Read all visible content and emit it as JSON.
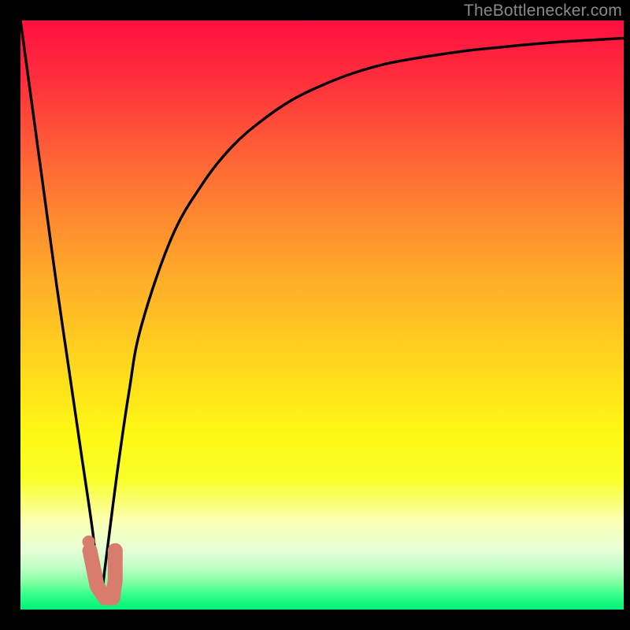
{
  "watermark": "TheBottlenecker.com",
  "colors": {
    "black": "#000000",
    "line": "#000000",
    "marker": "#d87c6e",
    "gradient_stops": [
      {
        "offset": 0.0,
        "color": "#ff0f3f"
      },
      {
        "offset": 0.1,
        "color": "#ff2f3c"
      },
      {
        "offset": 0.25,
        "color": "#ff6a35"
      },
      {
        "offset": 0.42,
        "color": "#ffa72a"
      },
      {
        "offset": 0.58,
        "color": "#ffd61e"
      },
      {
        "offset": 0.7,
        "color": "#fff714"
      },
      {
        "offset": 0.78,
        "color": "#f8ff2a"
      },
      {
        "offset": 0.85,
        "color": "#fbffb4"
      },
      {
        "offset": 0.9,
        "color": "#e6ffd5"
      },
      {
        "offset": 0.93,
        "color": "#bcffc5"
      },
      {
        "offset": 0.955,
        "color": "#7effa0"
      },
      {
        "offset": 0.975,
        "color": "#33ff8a"
      },
      {
        "offset": 1.0,
        "color": "#00f17a"
      }
    ]
  },
  "chart_data": {
    "type": "line",
    "title": "",
    "xlabel": "",
    "ylabel": "",
    "xlim": [
      0,
      100
    ],
    "ylim": [
      0,
      100
    ],
    "x": [
      0,
      2,
      4,
      6,
      8,
      10,
      12,
      13.2,
      14,
      16,
      18,
      20,
      25,
      30,
      35,
      40,
      45,
      50,
      55,
      60,
      65,
      70,
      75,
      80,
      85,
      90,
      95,
      100
    ],
    "values": [
      100,
      85,
      70,
      55,
      41,
      27,
      13,
      2,
      7,
      23,
      37,
      48,
      63,
      72,
      78.5,
      83,
      86.5,
      89,
      91,
      92.5,
      93.5,
      94.3,
      95,
      95.5,
      96,
      96.4,
      96.7,
      97
    ],
    "marker": {
      "shape": "J",
      "points": [
        {
          "x": 11.5,
          "y": 10
        },
        {
          "x": 12.7,
          "y": 4
        },
        {
          "x": 14.0,
          "y": 2
        },
        {
          "x": 15.3,
          "y": 2
        },
        {
          "x": 15.7,
          "y": 5
        },
        {
          "x": 15.7,
          "y": 10
        }
      ]
    },
    "legend": []
  }
}
